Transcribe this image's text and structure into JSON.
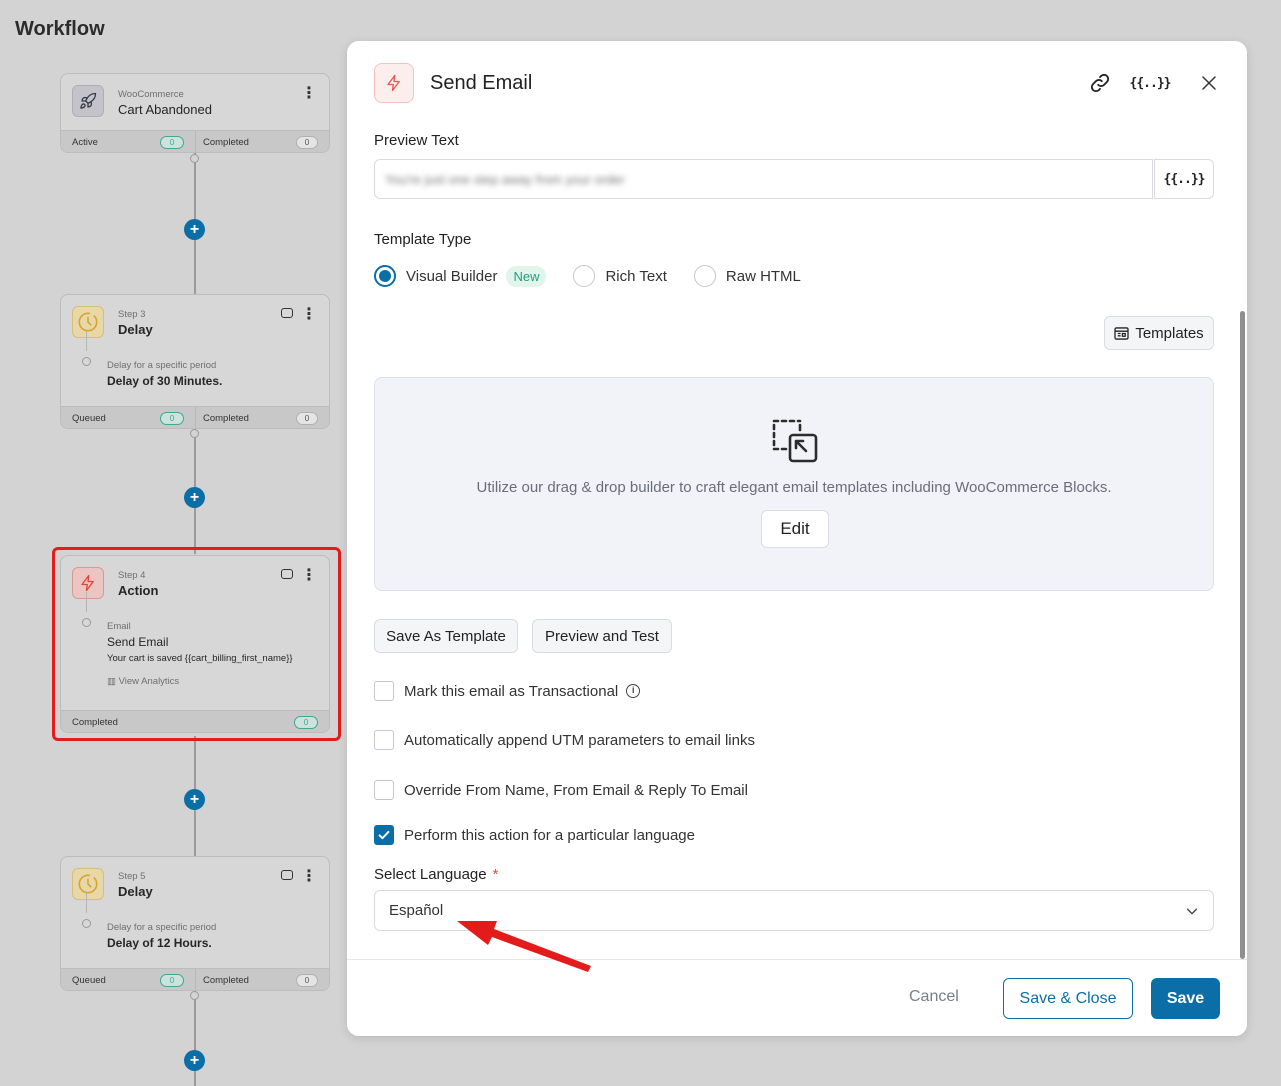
{
  "workflow": {
    "title": "Workflow",
    "cards": [
      {
        "sub": "WooCommerce",
        "name": "Cart Abandoned",
        "icon": "rocket-icon",
        "foot_left": "Active",
        "foot_left_count": "0",
        "foot_right": "Completed",
        "foot_right_count": "0"
      },
      {
        "sub": "Step 3",
        "name": "Delay",
        "icon": "clock-icon",
        "body_small": "Delay for a specific period",
        "body_main": "Delay of 30 Minutes.",
        "foot_left": "Queued",
        "foot_left_count": "0",
        "foot_right": "Completed",
        "foot_right_count": "0"
      },
      {
        "sub": "Step 4",
        "name": "Action",
        "icon": "bolt-icon",
        "body_small": "Email",
        "body_main": "Send Email",
        "body_extra": "Your cart is saved {{cart_billing_first_name}}",
        "analytics": "View Analytics",
        "foot_left": "Completed",
        "foot_left_count": "0"
      },
      {
        "sub": "Step 5",
        "name": "Delay",
        "icon": "clock-icon",
        "body_small": "Delay for a specific period",
        "body_main": "Delay of 12 Hours.",
        "foot_left": "Queued",
        "foot_left_count": "0",
        "foot_right": "Completed",
        "foot_right_count": "0"
      }
    ],
    "plus_label": "+"
  },
  "modal": {
    "title": "Send Email",
    "merge_tag_label": "{{..}}",
    "preview_text": {
      "label": "Preview Text",
      "value": "You're just one step away from your order"
    },
    "template_type": {
      "label": "Template Type",
      "options": [
        "Visual Builder",
        "Rich Text",
        "Raw HTML"
      ],
      "selected": "Visual Builder",
      "new_badge": "New"
    },
    "templates_button": "Templates",
    "builder": {
      "description": "Utilize our drag & drop builder to craft elegant email templates including WooCommerce Blocks.",
      "edit_label": "Edit"
    },
    "save_as_template": "Save As Template",
    "preview_and_test": "Preview and Test",
    "checkboxes": [
      {
        "label": "Mark this email as Transactional",
        "checked": false
      },
      {
        "label": "Automatically append UTM parameters to email links",
        "checked": false
      },
      {
        "label": "Override From Name, From Email & Reply To Email",
        "checked": false
      },
      {
        "label": "Perform this action for a particular language",
        "checked": true
      }
    ],
    "info_glyph": "i",
    "select_language": {
      "label": "Select Language",
      "required_mark": "*",
      "value": "Español"
    },
    "footer": {
      "cancel": "Cancel",
      "save_close": "Save & Close",
      "save": "Save"
    }
  },
  "colors": {
    "accent": "#0c6ea7",
    "highlight": "#e41b1b",
    "arrow": "#e41b1b",
    "new_badge_bg": "#e1f5ec",
    "new_badge_text": "#22a07a",
    "pill_green": "#3ea98d"
  }
}
